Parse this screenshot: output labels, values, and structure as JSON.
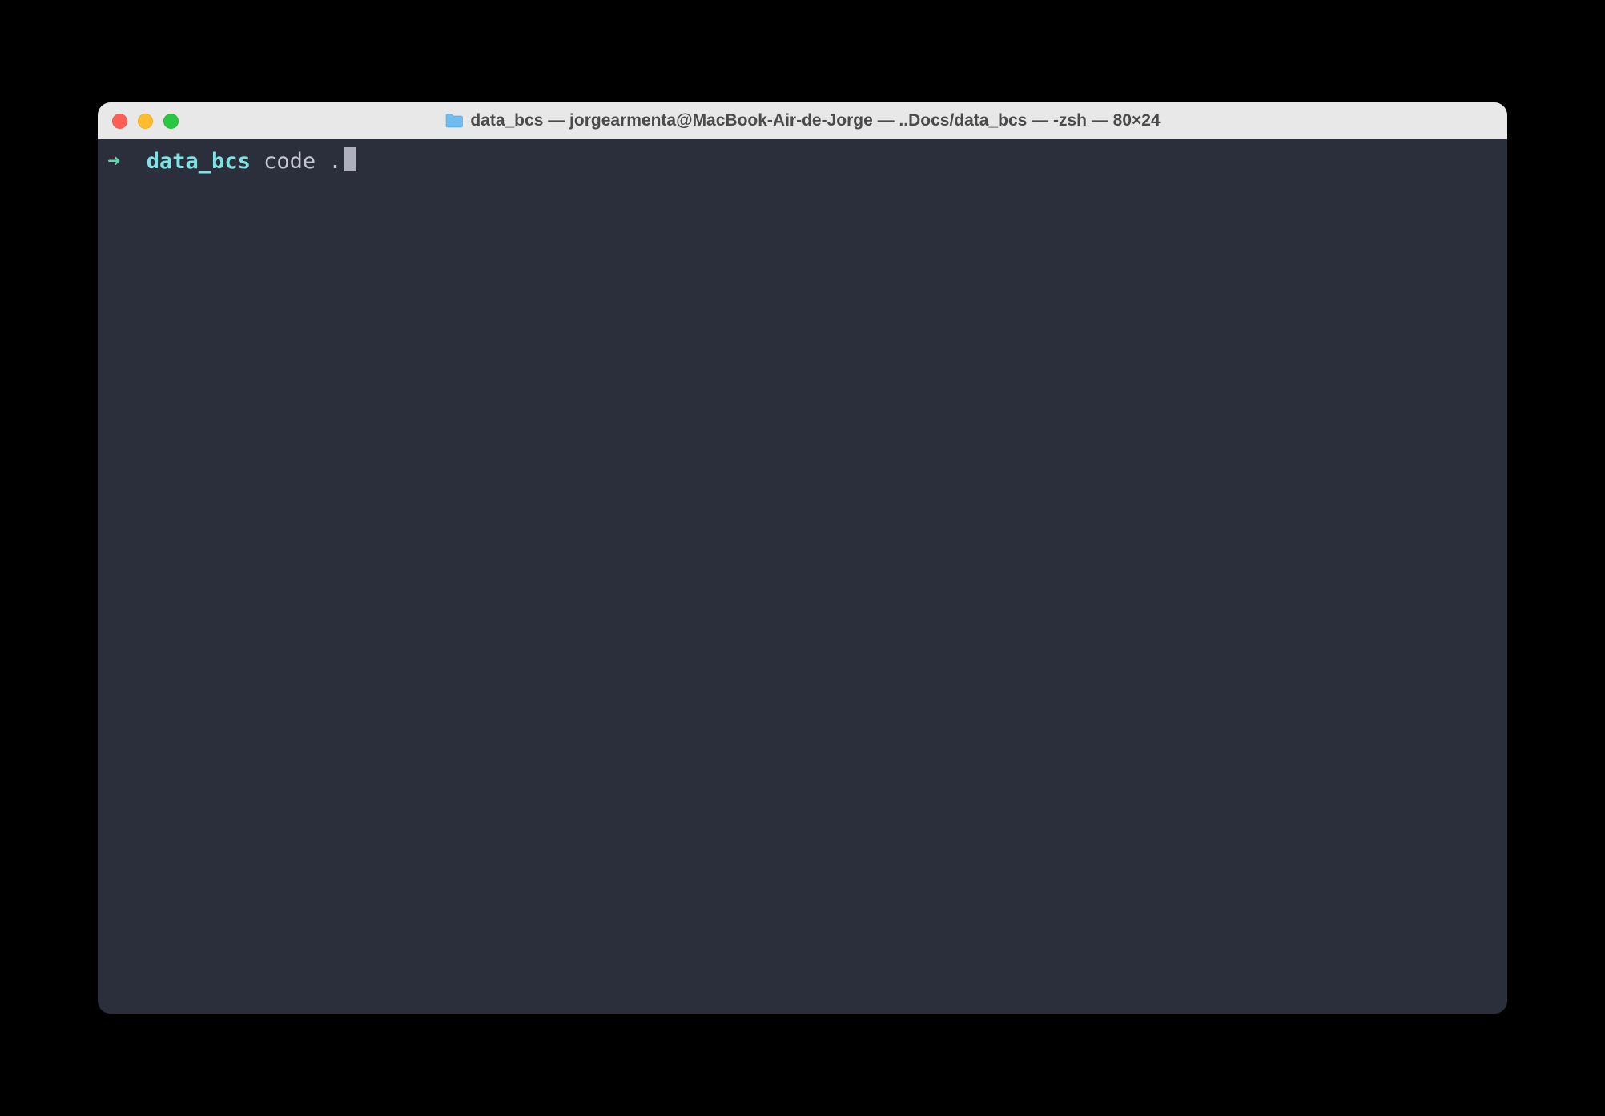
{
  "window": {
    "title": "data_bcs — jorgearmenta@MacBook-Air-de-Jorge — ..Docs/data_bcs — -zsh — 80×24"
  },
  "prompt": {
    "arrow": "➜",
    "path": "data_bcs",
    "command": "code ."
  }
}
